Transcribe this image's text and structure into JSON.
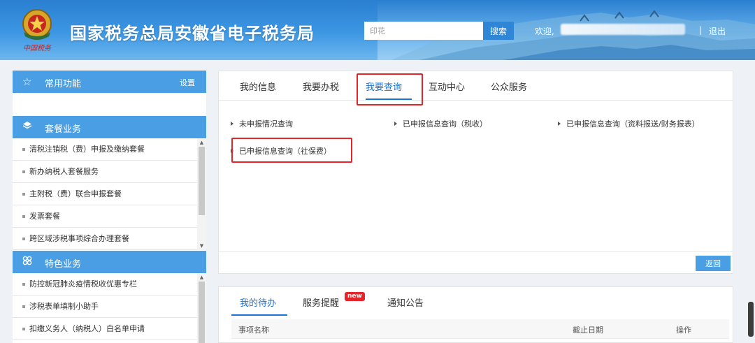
{
  "header": {
    "title": "国家税务总局安徽省电子税务局",
    "emblem_caption": "中国税务",
    "search_value": "印花",
    "search_button": "搜索",
    "welcome": "欢迎,",
    "separator": "|",
    "logout": "退出"
  },
  "sidebar": {
    "common": {
      "title": "常用功能",
      "settings": "设置",
      "icon": "star-outline-icon"
    },
    "package": {
      "title": "套餐业务",
      "icon": "layers-icon",
      "items": [
        "清税注销税（费）申报及缴纳套餐",
        "新办纳税人套餐服务",
        "主附税（费）联合申报套餐",
        "发票套餐",
        "跨区域涉税事项综合办理套餐"
      ]
    },
    "featured": {
      "title": "特色业务",
      "icon": "grid-four-icon",
      "items": [
        "防控新冠肺炎疫情税收优惠专栏",
        "涉税表单填制小助手",
        "扣缴义务人（纳税人）白名单申请"
      ]
    }
  },
  "main": {
    "tabs": [
      "我的信息",
      "我要办税",
      "我要查询",
      "互动中心",
      "公众服务"
    ],
    "active_tab": "我要查询",
    "links": [
      "未申报情况查询",
      "已申报信息查询（税收）",
      "已申报信息查询（资料报送/财务报表）",
      "已申报信息查询（社保费）"
    ],
    "back_button": "返回"
  },
  "bottom": {
    "tabs": [
      "我的待办",
      "服务提醒",
      "通知公告"
    ],
    "badge": "new",
    "columns": [
      "事项名称",
      "截止日期",
      "操作"
    ]
  },
  "colors": {
    "accent": "#1b74d0",
    "sidebar_header": "#4a9ee4",
    "highlight": "#e4252a"
  }
}
